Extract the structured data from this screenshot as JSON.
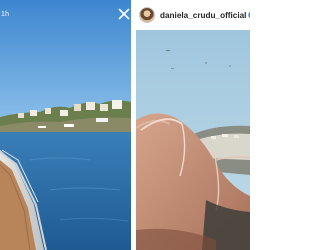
{
  "left_story": {
    "timestamp": "1h",
    "close_icon": "close-icon",
    "scene": "boat-bow-sea-coastline"
  },
  "right_post": {
    "username": "daniela_crudu_official",
    "verified_icon": "verified-badge-icon",
    "verified_color": "#3897f0",
    "scene": "sunbathing-sky-hills"
  },
  "colors": {
    "sky_left": "#4a90d0",
    "sea": "#2d6ea8",
    "skin": "#c8957c"
  }
}
